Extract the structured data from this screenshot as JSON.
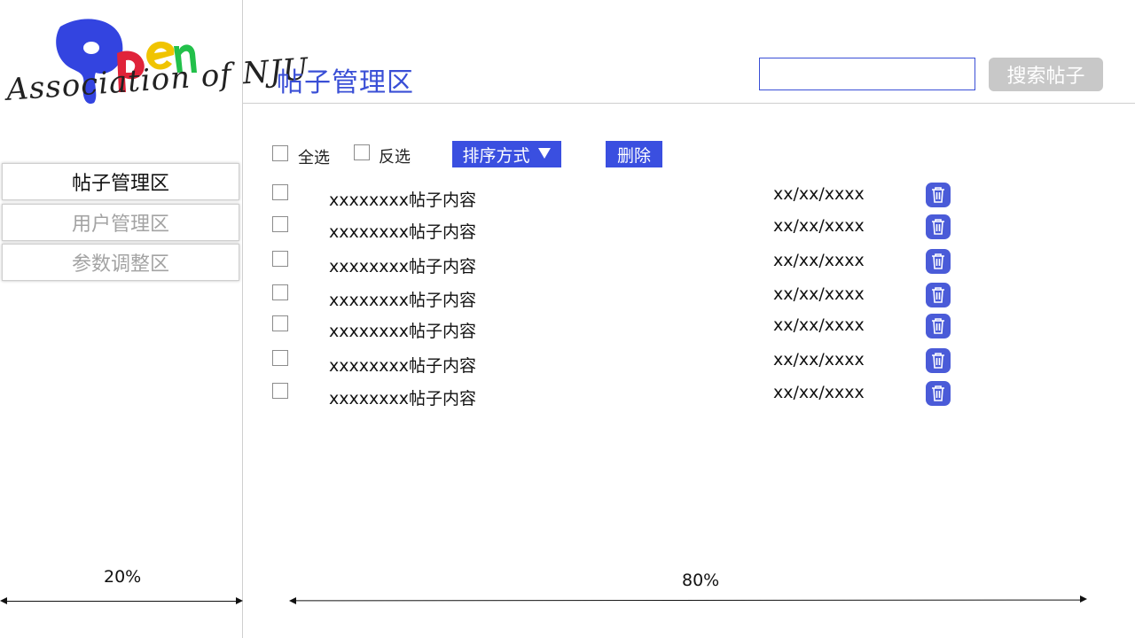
{
  "logo": {
    "brand_word": "Open",
    "tagline": "Association of NJU",
    "colors": {
      "o": "#3344e0",
      "p": "#e0233a",
      "e": "#f0c400",
      "n": "#22c04a"
    }
  },
  "sidebar": {
    "items": [
      {
        "label": "帖子管理区",
        "active": true
      },
      {
        "label": "用户管理区",
        "active": false
      },
      {
        "label": "参数调整区",
        "active": false
      }
    ]
  },
  "header": {
    "title": "帖子管理区",
    "search_value": "",
    "search_button": "搜索帖子"
  },
  "toolbar": {
    "select_all": "全选",
    "invert_select": "反选",
    "sort_label": "排序方式",
    "delete_label": "删除"
  },
  "posts": [
    {
      "content": "xxxxxxxx帖子内容",
      "date": "xx/xx/xxxx",
      "icon": "trash-icon"
    },
    {
      "content": "xxxxxxxx帖子内容",
      "date": "xx/xx/xxxx",
      "icon": "trash-icon"
    },
    {
      "content": "xxxxxxxx帖子内容",
      "date": "xx/xx/xxxx",
      "icon": "trash-icon"
    },
    {
      "content": "xxxxxxxx帖子内容",
      "date": "xx/xx/xxxx",
      "icon": "trash-icon"
    },
    {
      "content": "xxxxxxxx帖子内容",
      "date": "xx/xx/xxxx",
      "icon": "trash-icon"
    },
    {
      "content": "xxxxxxxx帖子内容",
      "date": "xx/xx/xxxx",
      "icon": "trash-icon"
    },
    {
      "content": "xxxxxxxx帖子内容",
      "date": "xx/xx/xxxx",
      "icon": "trash-icon"
    }
  ],
  "annotations": {
    "sidebar_width": "20%",
    "main_width": "80%"
  },
  "colors": {
    "accent": "#3a4fe0",
    "title": "#3a4fd6",
    "trash": "#4a5bd8",
    "search_button": "#c8c8c8",
    "inactive_text": "#a3a3a3"
  }
}
